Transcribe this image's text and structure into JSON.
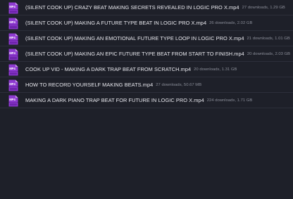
{
  "colors": {
    "background": "#1e2029",
    "divider": "#2c2f3a",
    "file_name": "#e9e9ef",
    "file_meta": "#8a8d98",
    "icon_purple": "#8e3ad0",
    "icon_label": "#ffffff"
  },
  "icon": {
    "name": "mp4-file-icon",
    "label": "MP4"
  },
  "files": [
    {
      "name": "(SILENT COOK UP) CRAZY BEAT MAKING SECRETS REVEALED IN LOGIC PRO X.mp4",
      "downloads": "27 downloads",
      "size": "1.29 GB"
    },
    {
      "name": "(SILENT COOK UP) MAKING A FUTURE TYPE BEAT IN LOGIC PRO X.mp4",
      "downloads": "26 downloads",
      "size": "2.02 GB"
    },
    {
      "name": "(SILENT COOK UP) MAKING AN EMOTIONAL FUTURE TYPE LOOP IN LOGIC PRO X.mp4",
      "downloads": "21 downloads",
      "size": "1.01 GB"
    },
    {
      "name": "(SILENT COOK UP) MAKING AN EPIC FUTURE TYPE BEAT FROM START TO FINISH.mp4",
      "downloads": "20 downloads",
      "size": "2.03 GB"
    },
    {
      "name": "COOK UP VID - MAKING A DARK TRAP BEAT FROM SCRATCH.mp4",
      "downloads": "20 downloads",
      "size": "1.31 GB"
    },
    {
      "name": "HOW TO RECORD YOURSELF MAKING BEATS.mp4",
      "downloads": "27 downloads",
      "size": "50.67 MB"
    },
    {
      "name": "MAKING A DARK PIANO TRAP BEAT FOR FUTURE IN LOGIC PRO X.mp4",
      "downloads": "224 downloads",
      "size": "1.71 GB"
    }
  ]
}
